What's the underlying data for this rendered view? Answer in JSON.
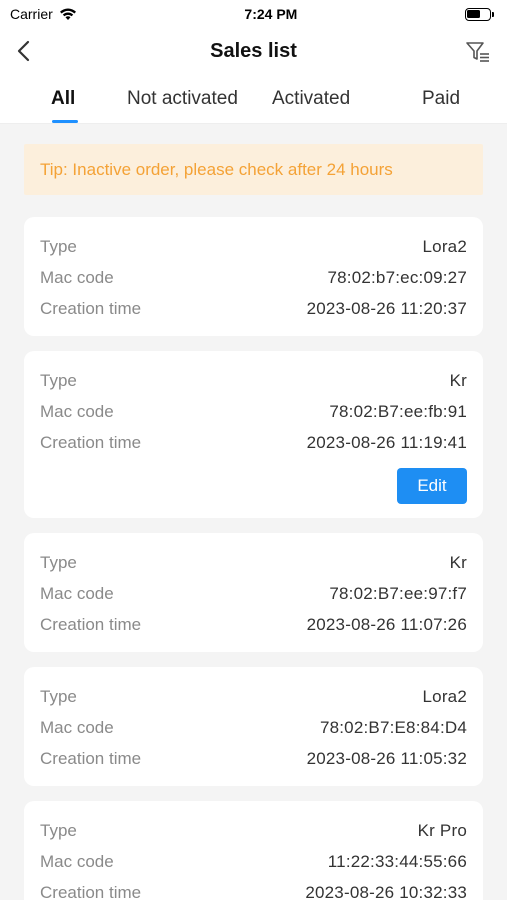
{
  "status_bar": {
    "carrier": "Carrier",
    "time": "7:24 PM"
  },
  "nav": {
    "title": "Sales list",
    "back_icon": "chevron-left-icon",
    "filter_icon": "filter-list-icon"
  },
  "tabs": [
    {
      "label": "All",
      "active": true
    },
    {
      "label": "Not activated",
      "active": false
    },
    {
      "label": "Activated",
      "active": false
    },
    {
      "label": "Paid",
      "active": false
    }
  ],
  "tip": "Tip: Inactive order, please check after 24 hours",
  "labels": {
    "type": "Type",
    "mac": "Mac code",
    "created": "Creation time"
  },
  "orders": [
    {
      "type": "Lora2",
      "mac": "78:02:b7:ec:09:27",
      "created": "2023-08-26 11:20:37"
    },
    {
      "type": "Kr",
      "mac": "78:02:B7:ee:fb:91",
      "created": "2023-08-26 11:19:41",
      "action": "Edit"
    },
    {
      "type": "Kr",
      "mac": "78:02:B7:ee:97:f7",
      "created": "2023-08-26 11:07:26"
    },
    {
      "type": "Lora2",
      "mac": "78:02:B7:E8:84:D4",
      "created": "2023-08-26 11:05:32"
    },
    {
      "type": "Kr Pro",
      "mac": "11:22:33:44:55:66",
      "created": "2023-08-26 10:32:33"
    }
  ],
  "colors": {
    "accent": "#1e8ef3",
    "tip_bg": "#fcefdc",
    "tip_text": "#f4a236",
    "page_bg": "#f4f4f4"
  }
}
